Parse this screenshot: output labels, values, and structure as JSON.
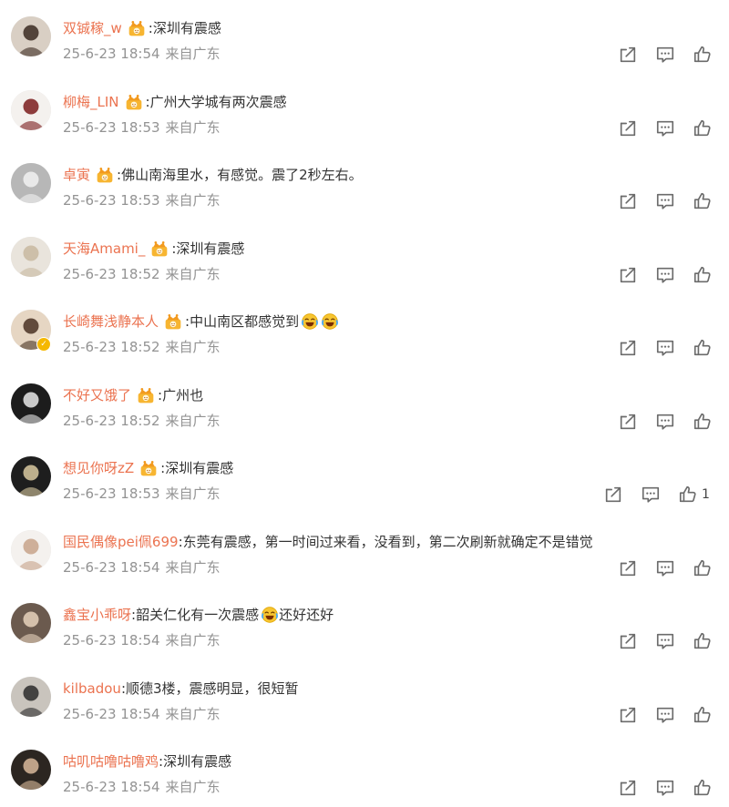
{
  "comments": [
    {
      "username": "双铖稼_w",
      "vip": true,
      "text": ":深圳有震感",
      "emojis": [],
      "text2": "",
      "time": "25-6-23 18:54",
      "source": "来自广东",
      "likes": "",
      "avatar_bg": "#d9cfc4",
      "avatar_fg": "#3a2a22",
      "verified": false
    },
    {
      "username": "柳梅_LIN",
      "vip": true,
      "text": ":广州大学城有两次震感",
      "emojis": [],
      "text2": "",
      "time": "25-6-23 18:53",
      "source": "来自广东",
      "likes": "",
      "avatar_bg": "#f4f1ee",
      "avatar_fg": "#7a1c1c",
      "verified": false
    },
    {
      "username": "卓寅",
      "vip": true,
      "text": ":佛山南海里水，有感觉。震了2秒左右。",
      "emojis": [],
      "text2": "",
      "time": "25-6-23 18:53",
      "source": "来自广东",
      "likes": "",
      "avatar_bg": "#b7b7b7",
      "avatar_fg": "#f2f2f2",
      "verified": false
    },
    {
      "username": "天海Amami_",
      "vip": true,
      "text": ":深圳有震感",
      "emojis": [],
      "text2": "",
      "time": "25-6-23 18:52",
      "source": "来自广东",
      "likes": "",
      "avatar_bg": "#e9e4dc",
      "avatar_fg": "#c8b9a0",
      "verified": false
    },
    {
      "username": "长崎舞浅静本人",
      "vip": true,
      "text": ":中山南区都感觉到",
      "emojis": [
        "laugh-cry-emoji",
        "laugh-cry-emoji"
      ],
      "text2": "",
      "time": "25-6-23 18:52",
      "source": "来自广东",
      "likes": "",
      "avatar_bg": "#e6d6c3",
      "avatar_fg": "#4a3324",
      "verified": true
    },
    {
      "username": "不好又饿了",
      "vip": true,
      "text": ":广州也",
      "emojis": [],
      "text2": "",
      "time": "25-6-23 18:52",
      "source": "来自广东",
      "likes": "",
      "avatar_bg": "#1c1c1c",
      "avatar_fg": "#e8e8e8",
      "verified": false
    },
    {
      "username": "想见你呀zZ",
      "vip": true,
      "text": ":深圳有震感",
      "emojis": [],
      "text2": "",
      "time": "25-6-23 18:53",
      "source": "来自广东",
      "likes": "1",
      "avatar_bg": "#1e1e1e",
      "avatar_fg": "#d9c9a0",
      "verified": false
    },
    {
      "username": "国民偶像pei佩699",
      "vip": false,
      "text": ":东莞有震感，第一时间过来看，没看到，第二次刷新就确定不是错觉",
      "emojis": [],
      "text2": "",
      "time": "25-6-23 18:54",
      "source": "来自广东",
      "likes": "",
      "avatar_bg": "#f4f1ee",
      "avatar_fg": "#c7a38a",
      "verified": false
    },
    {
      "username": "鑫宝小乖呀",
      "vip": false,
      "text": ":韶关仁化有一次震感",
      "emojis": [
        "laugh-cry-emoji"
      ],
      "text2": " 还好还好",
      "time": "25-6-23 18:54",
      "source": "来自广东",
      "likes": "",
      "avatar_bg": "#6b5a4e",
      "avatar_fg": "#e6d2bc",
      "verified": false
    },
    {
      "username": "kilbadou",
      "vip": false,
      "text": ":顺德3楼，震感明显，很短暂",
      "emojis": [],
      "text2": "",
      "time": "25-6-23 18:54",
      "source": "来自广东",
      "likes": "",
      "avatar_bg": "#c9c4bd",
      "avatar_fg": "#2b2b2b",
      "verified": false
    },
    {
      "username": "咕叽咕噜咕噜鸡",
      "vip": false,
      "text": ":深圳有震感",
      "emojis": [],
      "text2": "",
      "time": "25-6-23 18:54",
      "source": "来自广东",
      "likes": "",
      "avatar_bg": "#2c2621",
      "avatar_fg": "#d8b99a",
      "verified": false
    }
  ],
  "icons": {
    "share": "share-icon",
    "comment": "comment-icon",
    "like": "thumbs-up-icon",
    "vip": "vip-crown-icon"
  },
  "colors": {
    "username": "#eb7350",
    "text": "#333333",
    "meta": "#939393",
    "icon": "#6b6b6b",
    "vip": "#f5a623"
  }
}
